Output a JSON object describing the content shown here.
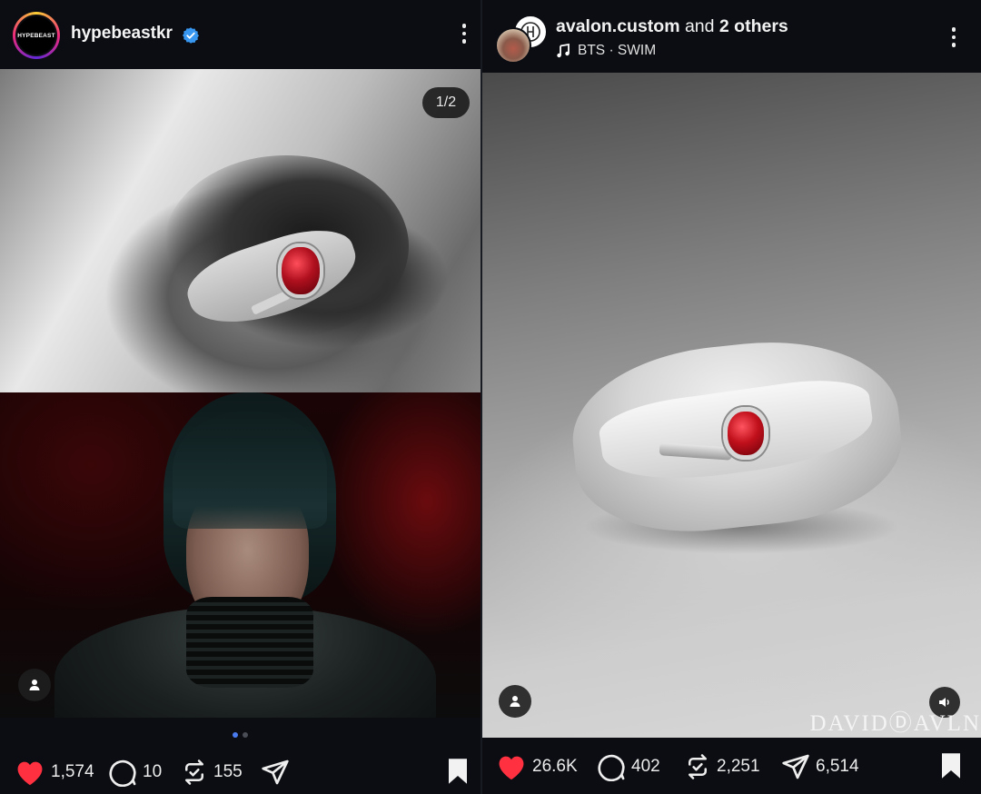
{
  "left_post": {
    "username": "hypebeastkr",
    "avatar_text": "HYPEBEAST",
    "verified": true,
    "slide_counter": "1/2",
    "carousel": {
      "count": 2,
      "active_index": 0
    },
    "likes": "1,574",
    "comments": "10",
    "reposts": "155"
  },
  "right_post": {
    "username": "avalon.custom",
    "collab_text": " and ",
    "collab_others": "2 others",
    "music": "BTS · SWIM",
    "watermark": "DAVIDⒹAVLN",
    "likes": "26.6K",
    "comments": "402",
    "reposts": "2,251",
    "shares": "6,514"
  },
  "colors": {
    "background": "#0b0d12",
    "like_red": "#ff3040",
    "verified_blue": "#3897f0",
    "carousel_active": "#4a7cf0"
  },
  "icons": [
    "more-icon",
    "verified-icon",
    "user-tag-icon",
    "heart-icon",
    "comment-icon",
    "repost-icon",
    "share-icon",
    "bookmark-icon",
    "music-note-icon",
    "volume-icon"
  ]
}
